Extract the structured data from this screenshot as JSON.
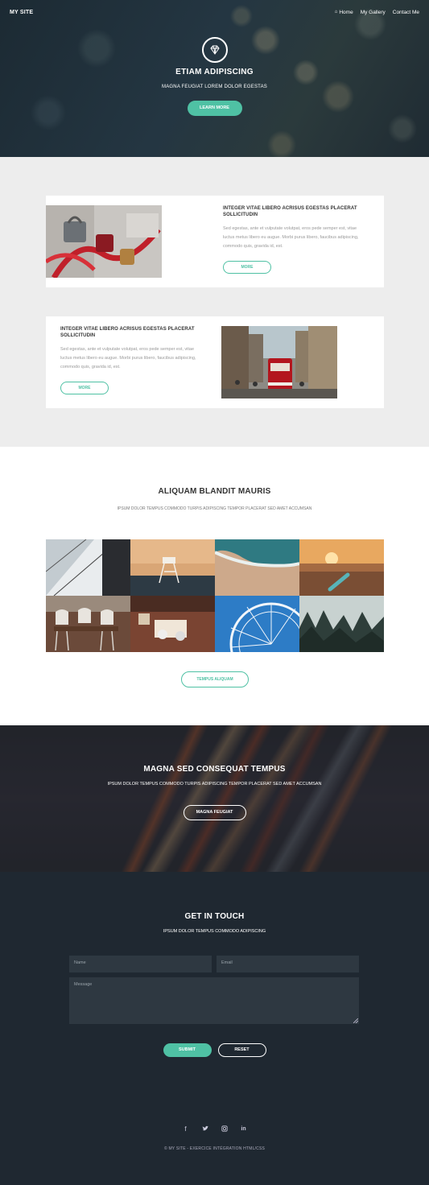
{
  "nav": {
    "logo": "MY SITE",
    "links": [
      {
        "label": "Home",
        "icon": "home-icon"
      },
      {
        "label": "My Gallery"
      },
      {
        "label": "Contact Me"
      }
    ]
  },
  "hero": {
    "icon": "diamond-icon",
    "title": "ETIAM ADIPISCING",
    "subtitle": "MAGNA FEUGIAT LOREM DOLOR EGESTAS",
    "button": "LEARN MORE"
  },
  "features": [
    {
      "title": "INTEGER VITAE LIBERO ACRISUS EGESTAS PLACERAT SOLLICITUDIN",
      "body": "Sed egestas, ante et vulputate volutpat, eros pede semper est, vitae luctus metus libero eu augue. Morbi purus libero, faucibus adipiscing, commodo quis, gravida id, est.",
      "button": "MORE",
      "image": "padlocks-photo"
    },
    {
      "title": "INTEGER VITAE LIBERO ACRISUS EGESTAS PLACERAT SOLLICITUDIN",
      "body": "Sed egestas, ante et vulputate volutpat, eros pede semper est, vitae luctus metus libero eu augue. Morbi purus libero, faucibus adipiscing, commodo quis, gravida id, est.",
      "button": "MORE",
      "image": "red-tram-photo"
    }
  ],
  "gallery": {
    "title": "ALIQUAM BLANDIT MAURIS",
    "subtitle": "IPSUM DOLOR TEMPUS COMMODO TURPIS ADIPISCING TEMPOR PLACERAT SED AMET ACCUMSAN",
    "button": "TEMPUS ALIQUAM",
    "tiles": [
      "sailboat-photo",
      "lifeguard-tower-photo",
      "beach-waves-photo",
      "surfboard-sunset-photo",
      "dining-chairs-photo",
      "coffee-table-photo",
      "ferris-wheel-photo",
      "foggy-forest-photo"
    ]
  },
  "cta": {
    "title": "MAGNA SED CONSEQUAT TEMPUS",
    "subtitle": "IPSUM DOLOR TEMPUS COMMODO TURPIS ADIPISCING TEMPOR PLACERAT SED AMET ACCUMSAN",
    "button": "MAGNA FEUGIAT"
  },
  "contact": {
    "title": "GET IN TOUCH",
    "subtitle": "IPSUM DOLOR TEMPUS COMMODO ADIPISCING",
    "name_placeholder": "Name",
    "email_placeholder": "Email",
    "message_placeholder": "Message",
    "submit": "SUBMIT",
    "reset": "RESET"
  },
  "footer": {
    "socials": [
      "facebook-icon",
      "twitter-icon",
      "instagram-icon",
      "linkedin-icon"
    ],
    "copyright": "© MY SITE - EXERCICE INTÉGRATION HTML/CSS"
  },
  "colors": {
    "accent": "#4fc1a4",
    "dark": "#1f2831",
    "light_bg": "#ededed"
  }
}
